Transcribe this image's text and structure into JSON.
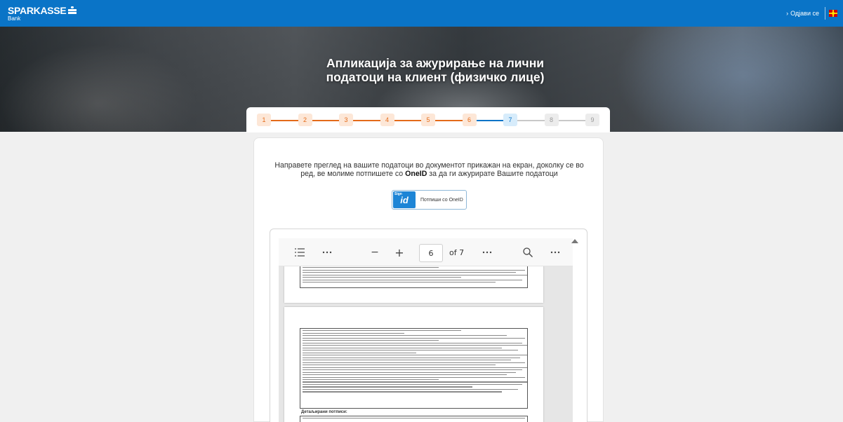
{
  "header": {
    "brand": "SPARKASSE",
    "brand_sub": "Bank",
    "logout_label": "Одјави се",
    "accent": "#0a74c7"
  },
  "hero": {
    "title_line1": "Апликација за ажурирање на лични",
    "title_line2": "податоци на клиент (физичко лице)"
  },
  "stepper": {
    "steps": [
      {
        "label": "1",
        "state": "done"
      },
      {
        "label": "2",
        "state": "done"
      },
      {
        "label": "3",
        "state": "done"
      },
      {
        "label": "4",
        "state": "done"
      },
      {
        "label": "5",
        "state": "done"
      },
      {
        "label": "6",
        "state": "done"
      },
      {
        "label": "7",
        "state": "active"
      },
      {
        "label": "8",
        "state": "todo"
      },
      {
        "label": "9",
        "state": "todo"
      }
    ],
    "colors": {
      "done": "#e46b1a",
      "active": "#0a74c7",
      "todo": "#c8c8c8"
    }
  },
  "main": {
    "instruction_part1": "Направете преглед на вашите податоци во документот прикажан на екран, доколку се во ред, ве молиме потпишете со ",
    "instruction_bold": "OneID",
    "instruction_part2": " за да ги ажурирате Вашите податоци",
    "oneid_button": {
      "logo_small": "Sign",
      "logo_text": "id",
      "label": "Потпиши со OneID"
    }
  },
  "pdf_viewer": {
    "toolbar": {
      "toc_icon": "list-icon",
      "more_icon": "more-horizontal-icon",
      "zoom_out": "−",
      "zoom_in": "+",
      "current_page": "6",
      "page_count": "of 7",
      "search_icon": "search-icon"
    },
    "page_b_heading": "Детаљирани потписи:"
  }
}
